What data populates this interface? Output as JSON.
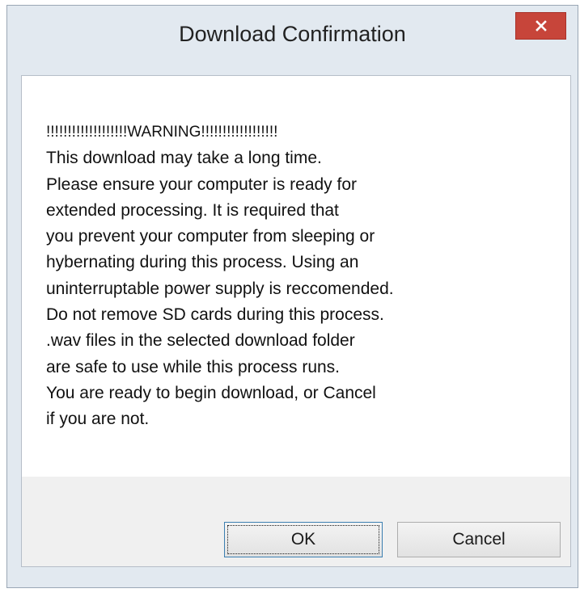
{
  "dialog": {
    "title": "Download Confirmation",
    "close_icon": "close-icon",
    "close_color": "#c7453a"
  },
  "message": {
    "lines": [
      "!!!!!!!!!!!!!!!!!!!WARNING!!!!!!!!!!!!!!!!!!",
      "This download may take a long time.",
      "Please ensure your computer is ready for",
      "extended processing. It is required that",
      "you prevent your computer from sleeping or",
      "hybernating during this process. Using an",
      "uninterruptable power supply is reccomended.",
      "Do not remove SD cards during this process.",
      ".wav files in the selected download folder",
      "are safe to use while this process runs.",
      "You are ready to begin download, or Cancel",
      "if you are not."
    ]
  },
  "buttons": {
    "ok_label": "OK",
    "cancel_label": "Cancel"
  }
}
